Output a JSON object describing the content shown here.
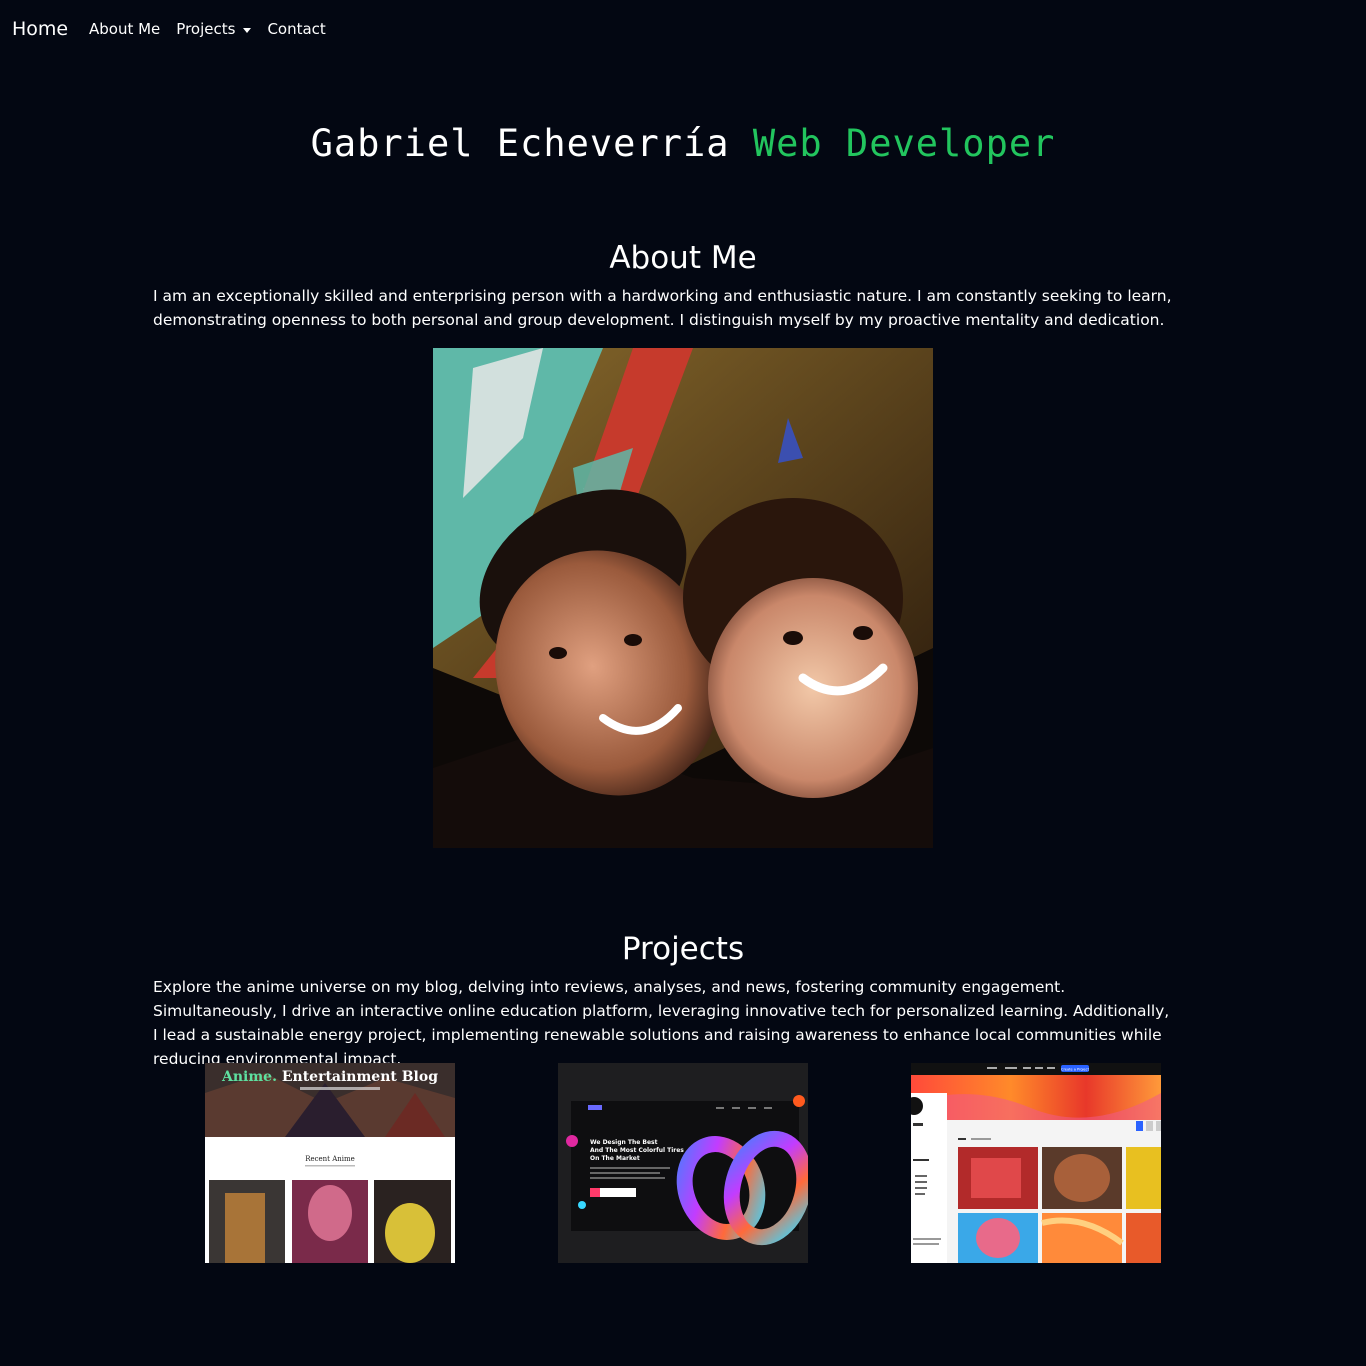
{
  "nav": {
    "brand": "Home",
    "links": [
      {
        "label": "About Me"
      },
      {
        "label": "Projects",
        "dropdown": true
      },
      {
        "label": "Contact"
      }
    ]
  },
  "hero": {
    "name": "Gabriel Echeverría",
    "role": "Web Developer",
    "role_color": "#22c55e"
  },
  "about": {
    "title": "About Me",
    "text": "I am an exceptionally skilled and enterprising person with a hardworking and enthusiastic nature. I am constantly seeking to learn, demonstrating openness to both personal and group development. I distinguish myself by my proactive mentality and dedication."
  },
  "projects": {
    "title": "Projects",
    "text": "Explore the anime universe on my blog, delving into reviews, analyses, and news, fostering community engagement. Simultaneously, I drive an interactive online education platform, leveraging innovative tech for personalized learning. Additionally, I lead a sustainable energy project, implementing renewable solutions and raising awareness to enhance local communities while reducing environmental impact.",
    "thumbs": [
      {
        "blog_title_accent": "Anime.",
        "blog_title_rest": " Entertainment Blog",
        "section_label": "Recent Anime"
      },
      {
        "headline_1": "We Design The Best",
        "headline_2": "And The Most Colorful Tires",
        "headline_3": "On The Market"
      },
      {
        "create_button": "Create a Project"
      }
    ]
  },
  "colors": {
    "background": "#030712",
    "accent_green": "#22c55e"
  }
}
